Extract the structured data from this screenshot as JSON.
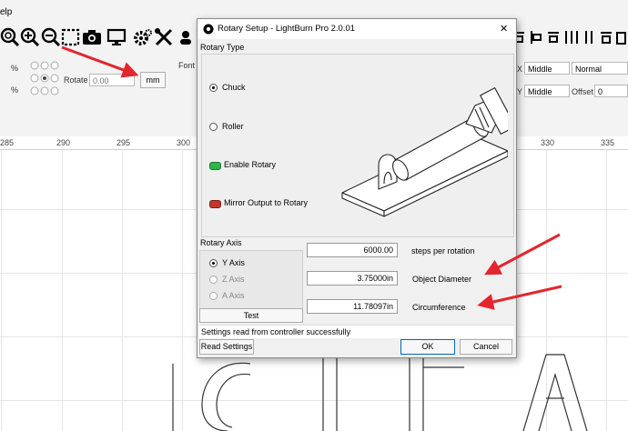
{
  "menu": {
    "help_fragment": "elp"
  },
  "toolbar2": {
    "pct1": "%",
    "pct2": "%",
    "rotate_label": "Rotate",
    "rotate_value": "0.00",
    "unit_button": "mm",
    "font_label": "Font",
    "x_label": "X",
    "y_label": "Y",
    "x_align": "Middle",
    "y_align": "Middle",
    "style_select": "Normal",
    "offset_label": "Offset",
    "offset_value": "0"
  },
  "ruler": {
    "ticks": [
      "285",
      "290",
      "295",
      "300",
      "330",
      "335"
    ]
  },
  "dialog": {
    "title": "Rotary Setup - LightBurn Pro 2.0.01",
    "rotary_type_label": "Rotary Type",
    "chuck_label": "Chuck",
    "roller_label": "Roller",
    "enable_rotary_label": "Enable Rotary",
    "mirror_output_label": "Mirror Output to Rotary",
    "rotary_axis_label": "Rotary Axis",
    "y_axis_label": "Y Axis",
    "z_axis_label": "Z Axis",
    "a_axis_label": "A Axis",
    "test_button": "Test",
    "steps_value": "6000.00",
    "steps_label": "steps per rotation",
    "diameter_value": "3.75000in",
    "diameter_label": "Object Diameter",
    "circumference_value": "11.78097in",
    "circumference_label": "Circumference",
    "status_text": "Settings read from controller successfully",
    "read_settings_button": "Read Settings",
    "ok_button": "OK",
    "cancel_button": "Cancel",
    "close_glyph": "✕"
  },
  "colors": {
    "annotation_arrow": "#e3262e",
    "toggle_on": "#2fb34a",
    "toggle_off": "#c0392b"
  }
}
